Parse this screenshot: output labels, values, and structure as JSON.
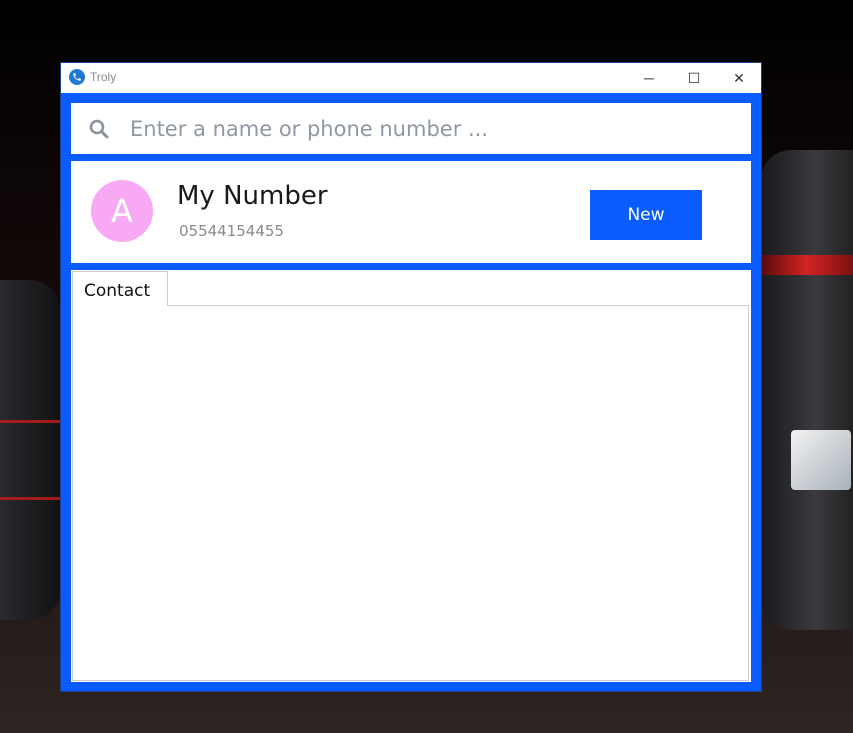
{
  "window": {
    "title": "Troly",
    "controls": {
      "minimize": "─",
      "maximize": "☐",
      "close": "✕"
    }
  },
  "search": {
    "placeholder": "Enter a name or phone number ...",
    "value": ""
  },
  "my_number": {
    "avatar_letter": "A",
    "name": "My Number",
    "phone": "05544154455",
    "new_label": "New"
  },
  "tabs": [
    {
      "label": "Contact",
      "selected": true
    }
  ],
  "colors": {
    "accent": "#0a5cff",
    "avatar": "#f7a9f4",
    "app_icon": "#1f78d6"
  },
  "icons": {
    "app": "phone-icon",
    "search": "search-icon"
  }
}
